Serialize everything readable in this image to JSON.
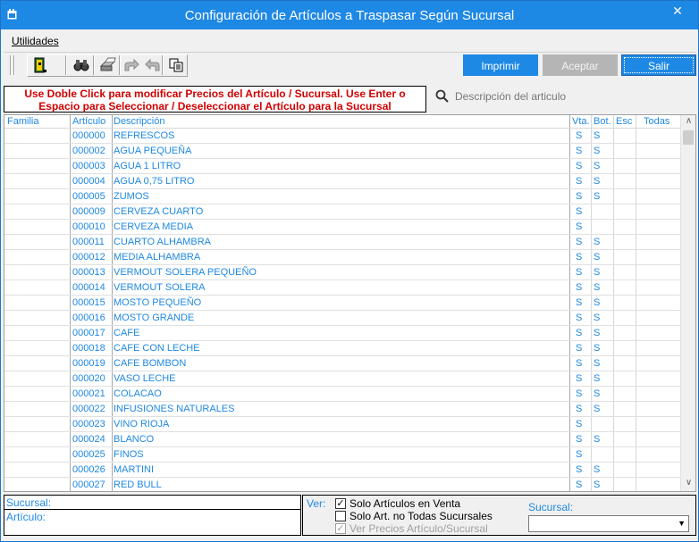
{
  "window": {
    "title": "Configuración de Artículos a Traspasar Según Sucursal",
    "close_glyph": "✕"
  },
  "menu": {
    "utilidades": "Utilidades"
  },
  "buttons": {
    "imprimir": "Imprimir",
    "aceptar": "Aceptar",
    "salir": "Salir"
  },
  "info": {
    "line1": "Use Doble Click para modificar Precios del Artículo / Sucursal. Use Enter o",
    "line2": "Espacio para Seleccionar / Deseleccionar el Artículo para la Sucursal"
  },
  "search": {
    "placeholder": "Descripción del articulo"
  },
  "grid": {
    "headers": {
      "familia": "Familia",
      "articulo": "Artículo",
      "descripcion": "Descripción",
      "vta": "Vta.",
      "bot": "Bot.",
      "esc": "Esc",
      "todas": "Todas"
    },
    "rows": [
      {
        "familia": "",
        "articulo": "000000",
        "descripcion": "REFRESCOS",
        "vta": "S",
        "bot": "S",
        "esc": "",
        "todas": ""
      },
      {
        "familia": "",
        "articulo": "000002",
        "descripcion": "AGUA PEQUEÑA",
        "vta": "S",
        "bot": "S",
        "esc": "",
        "todas": ""
      },
      {
        "familia": "",
        "articulo": "000003",
        "descripcion": "AGUA 1 LITRO",
        "vta": "S",
        "bot": "S",
        "esc": "",
        "todas": ""
      },
      {
        "familia": "",
        "articulo": "000004",
        "descripcion": "AGUA 0,75 LITRO",
        "vta": "S",
        "bot": "S",
        "esc": "",
        "todas": ""
      },
      {
        "familia": "",
        "articulo": "000005",
        "descripcion": "ZUMOS",
        "vta": "S",
        "bot": "S",
        "esc": "",
        "todas": ""
      },
      {
        "familia": "",
        "articulo": "000009",
        "descripcion": "CERVEZA CUARTO",
        "vta": "S",
        "bot": "",
        "esc": "",
        "todas": ""
      },
      {
        "familia": "",
        "articulo": "000010",
        "descripcion": "CERVEZA MEDIA",
        "vta": "S",
        "bot": "",
        "esc": "",
        "todas": ""
      },
      {
        "familia": "",
        "articulo": "000011",
        "descripcion": "CUARTO ALHAMBRA",
        "vta": "S",
        "bot": "S",
        "esc": "",
        "todas": ""
      },
      {
        "familia": "",
        "articulo": "000012",
        "descripcion": "MEDIA ALHAMBRA",
        "vta": "S",
        "bot": "S",
        "esc": "",
        "todas": ""
      },
      {
        "familia": "",
        "articulo": "000013",
        "descripcion": "VERMOUT SOLERA PEQUEÑO",
        "vta": "S",
        "bot": "S",
        "esc": "",
        "todas": ""
      },
      {
        "familia": "",
        "articulo": "000014",
        "descripcion": "VERMOUT SOLERA",
        "vta": "S",
        "bot": "S",
        "esc": "",
        "todas": ""
      },
      {
        "familia": "",
        "articulo": "000015",
        "descripcion": "MOSTO PEQUEÑO",
        "vta": "S",
        "bot": "S",
        "esc": "",
        "todas": ""
      },
      {
        "familia": "",
        "articulo": "000016",
        "descripcion": "MOSTO GRANDE",
        "vta": "S",
        "bot": "S",
        "esc": "",
        "todas": ""
      },
      {
        "familia": "",
        "articulo": "000017",
        "descripcion": "CAFE",
        "vta": "S",
        "bot": "S",
        "esc": "",
        "todas": ""
      },
      {
        "familia": "",
        "articulo": "000018",
        "descripcion": "CAFE CON LECHE",
        "vta": "S",
        "bot": "S",
        "esc": "",
        "todas": ""
      },
      {
        "familia": "",
        "articulo": "000019",
        "descripcion": "CAFE BOMBON",
        "vta": "S",
        "bot": "S",
        "esc": "",
        "todas": ""
      },
      {
        "familia": "",
        "articulo": "000020",
        "descripcion": "VASO LECHE",
        "vta": "S",
        "bot": "S",
        "esc": "",
        "todas": ""
      },
      {
        "familia": "",
        "articulo": "000021",
        "descripcion": "COLACAO",
        "vta": "S",
        "bot": "S",
        "esc": "",
        "todas": ""
      },
      {
        "familia": "",
        "articulo": "000022",
        "descripcion": "INFUSIONES NATURALES",
        "vta": "S",
        "bot": "S",
        "esc": "",
        "todas": ""
      },
      {
        "familia": "",
        "articulo": "000023",
        "descripcion": "VINO RIOJA",
        "vta": "S",
        "bot": "",
        "esc": "",
        "todas": ""
      },
      {
        "familia": "",
        "articulo": "000024",
        "descripcion": "BLANCO",
        "vta": "S",
        "bot": "S",
        "esc": "",
        "todas": ""
      },
      {
        "familia": "",
        "articulo": "000025",
        "descripcion": "FINOS",
        "vta": "S",
        "bot": "",
        "esc": "",
        "todas": ""
      },
      {
        "familia": "",
        "articulo": "000026",
        "descripcion": "MARTINI",
        "vta": "S",
        "bot": "S",
        "esc": "",
        "todas": ""
      },
      {
        "familia": "",
        "articulo": "000027",
        "descripcion": "RED BULL",
        "vta": "S",
        "bot": "S",
        "esc": "",
        "todas": ""
      }
    ]
  },
  "footer": {
    "sucursal_label": "Sucursal:",
    "articulo_label": "Artículo:",
    "ver_label": "Ver:",
    "chk_venta": {
      "label": "Solo Artículos en Venta",
      "checked": true
    },
    "chk_no_todas": {
      "label": "Solo Art. no Todas Sucursales",
      "checked": false
    },
    "chk_precios": {
      "label": "Ver Precios Artículo/Sucursal",
      "checked": true,
      "disabled": true
    },
    "sucursal_select_label": "Sucursal:",
    "sucursal_select_value": ""
  },
  "colors": {
    "accent": "#1e88e5",
    "warning_text": "#d00000",
    "disabled_button": "#b5b5b5"
  },
  "icons": [
    "app-icon",
    "exit-door-icon",
    "binoculars-icon",
    "printer-icon",
    "forward-arrow-icon",
    "back-arrow-icon",
    "copy-icon",
    "search-icon"
  ]
}
